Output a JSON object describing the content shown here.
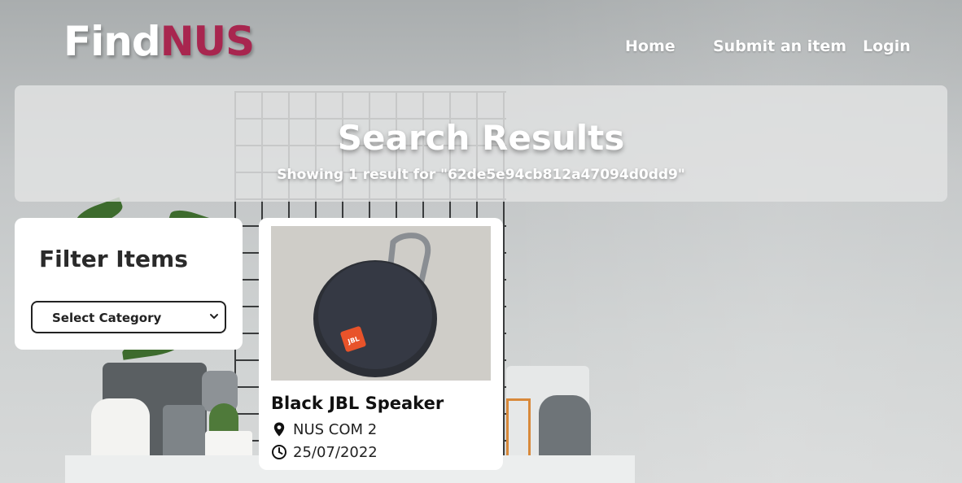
{
  "brand": {
    "part1": "Find",
    "part2": "NUS"
  },
  "nav": {
    "home": "Home",
    "submit": "Submit an item",
    "login": "Login"
  },
  "banner": {
    "title": "Search Results",
    "subtitle": "Showing 1 result for \"62de5e94cb812a47094d0dd9\""
  },
  "filter": {
    "title": "Filter Items",
    "select_value": "Select Category"
  },
  "results": [
    {
      "name": "Black JBL Speaker",
      "location": "NUS COM 2",
      "date": "25/07/2022",
      "image_label": "JBL"
    }
  ],
  "colors": {
    "brand_accent": "#a8264f",
    "card_bg": "#ffffff",
    "banner_bg": "#e1e2e2"
  },
  "icons": {
    "location": "location-pin-icon",
    "date": "clock-icon",
    "select": "chevron-down-icon"
  }
}
